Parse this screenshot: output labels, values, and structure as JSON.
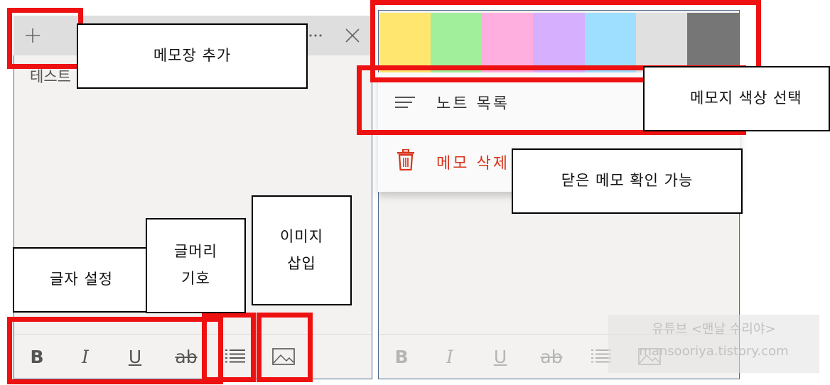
{
  "left_note": {
    "add_icon": "plus-icon",
    "more_icon": "ellipsis-icon",
    "close_icon": "close-icon",
    "text": "테스트",
    "toolbar": [
      {
        "label": "B",
        "icon": "bold-icon"
      },
      {
        "label": "I",
        "icon": "italic-icon"
      },
      {
        "label": "U",
        "icon": "underline-icon"
      },
      {
        "label": "ab",
        "icon": "strikethrough-icon"
      },
      {
        "icon": "bullet-list-icon"
      },
      {
        "icon": "image-icon"
      }
    ]
  },
  "right_note": {
    "colors": [
      "#ffe66e",
      "#a1ef9b",
      "#ffafdf",
      "#d7afff",
      "#9edfff",
      "#e0e0e0",
      "#767676"
    ],
    "menu": {
      "notes_list": "노트 목록",
      "delete_note": "메모 삭제"
    },
    "toolbar": [
      {
        "label": "B"
      },
      {
        "label": "I"
      },
      {
        "label": "U"
      },
      {
        "label": "ab"
      }
    ]
  },
  "callouts": {
    "add_memo": "메모장 추가",
    "text_format": "글자 설정",
    "bullet_symbol_line1": "글머리",
    "bullet_symbol_line2": "기호",
    "insert_image_line1": "이미지",
    "insert_image_line2": "삽입",
    "select_color": "메모지 색상 선택",
    "view_closed_memo": "닫은 메모 확인 가능"
  },
  "watermark": {
    "line1": "유튜브 <맨날 수리야>",
    "line2": "mansooriya.tistory.com"
  }
}
